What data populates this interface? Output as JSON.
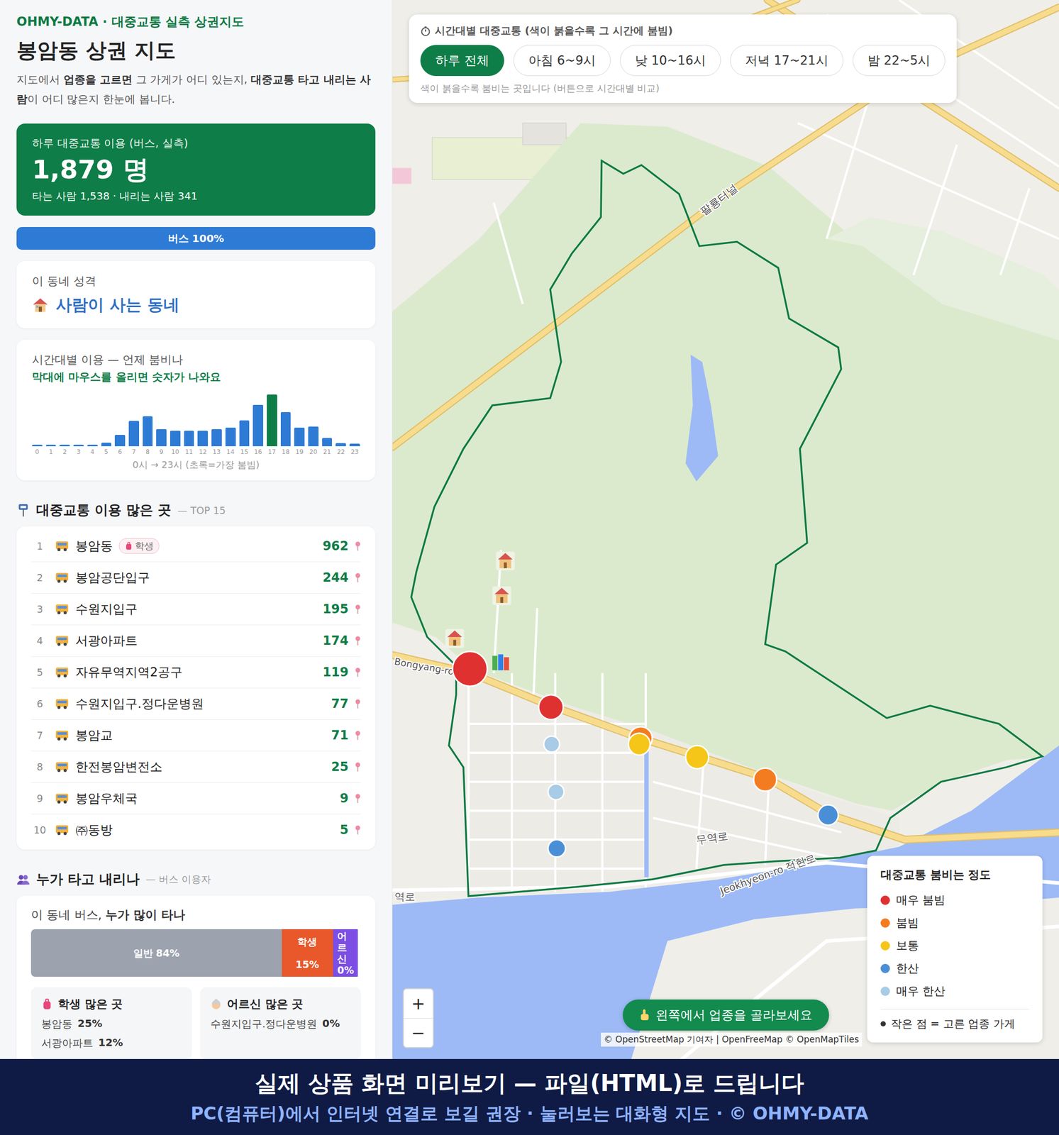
{
  "brand": "OHMY-DATA · 대중교통 실측 상권지도",
  "title": "봉암동 상권 지도",
  "description": [
    {
      "text": "지도에서 ",
      "bold": false
    },
    {
      "text": "업종을 고르면",
      "bold": true
    },
    {
      "text": " 그 가게가 어디 있는지, ",
      "bold": false
    },
    {
      "text": "대중교통 타고 내리는 사람",
      "bold": true
    },
    {
      "text": "이 어디 많은지 한눈에 봅니다.",
      "bold": false
    }
  ],
  "total": {
    "label": "하루 대중교통 이용 (버스, 실측)",
    "value": "1,879 명",
    "sub": "타는 사람 1,538 · 내리는 사람 341"
  },
  "modes": [
    {
      "label": "버스 100%",
      "level": 1,
      "color": "#2e7bd6"
    }
  ],
  "character": {
    "label": "이 동네 성격",
    "value": "사람이 사는 동네"
  },
  "hourly": {
    "title": "시간대별 이용 — 언제 붐비나",
    "hint": "막대에 마우스를 올리면 숫자가 나와요",
    "values": [
      6,
      5,
      5,
      6,
      5,
      18,
      56,
      124,
      148,
      84,
      76,
      76,
      76,
      84,
      92,
      128,
      204,
      255,
      168,
      92,
      96,
      40,
      16,
      12
    ],
    "peak": 17,
    "ticks": [
      "0",
      "1",
      "2",
      "3",
      "4",
      "5",
      "6",
      "7",
      "8",
      "9",
      "10",
      "11",
      "12",
      "13",
      "14",
      "15",
      "16",
      "17",
      "18",
      "19",
      "20",
      "21",
      "22",
      "23"
    ],
    "caption": "0시 → 23시 (초록=가장 붐빔)"
  },
  "top_stops": {
    "title": "대중교통 이용 많은 곳",
    "suffix": "— TOP 15",
    "items": [
      {
        "rank": "1",
        "name": "봉암동",
        "badge": "학생",
        "count": "962"
      },
      {
        "rank": "2",
        "name": "봉암공단입구",
        "badge": "",
        "count": "244"
      },
      {
        "rank": "3",
        "name": "수원지입구",
        "badge": "",
        "count": "195"
      },
      {
        "rank": "4",
        "name": "서광아파트",
        "badge": "",
        "count": "174"
      },
      {
        "rank": "5",
        "name": "자유무역지역2공구",
        "badge": "",
        "count": "119"
      },
      {
        "rank": "6",
        "name": "수원지입구.정다운병원",
        "badge": "",
        "count": "77"
      },
      {
        "rank": "7",
        "name": "봉암교",
        "badge": "",
        "count": "71"
      },
      {
        "rank": "8",
        "name": "한전봉암변전소",
        "badge": "",
        "count": "25"
      },
      {
        "rank": "9",
        "name": "봉암우체국",
        "badge": "",
        "count": "9"
      },
      {
        "rank": "10",
        "name": "㈜동방",
        "badge": "",
        "count": "5"
      }
    ]
  },
  "riders": {
    "title": "누가 타고 내리나",
    "suffix": "— 버스 이용자",
    "question": [
      {
        "text": "이 동네 버스, ",
        "bold": false
      },
      {
        "text": "누가 많이 타나",
        "bold": true
      }
    ],
    "segments": [
      {
        "label": "일반",
        "value": "84%",
        "level": 0.84,
        "color": "#9ca3af"
      },
      {
        "label": "학생",
        "value": "15%",
        "level": 0.15,
        "color": "#e8582a"
      },
      {
        "label": "어르신",
        "value": "0%",
        "level": 0.0,
        "color": "#7c4ee4"
      }
    ],
    "groups": [
      {
        "title": "학생 많은 곳",
        "items": [
          {
            "name": "봉암동",
            "value": "25%"
          },
          {
            "name": "서광아파트",
            "value": "12%"
          }
        ]
      },
      {
        "title": "어르신 많은 곳",
        "items": [
          {
            "name": "수원지입구.정다운병원",
            "value": "0%"
          }
        ]
      }
    ]
  },
  "time_filter": {
    "title": "시간대별 대중교통 (색이 붉을수록 그 시간에 붐빔)",
    "options": [
      {
        "label": "하루 전체",
        "selected": true
      },
      {
        "label": "아침 6~9시",
        "selected": false
      },
      {
        "label": "낮 10~16시",
        "selected": false
      },
      {
        "label": "저녁 17~21시",
        "selected": false
      },
      {
        "label": "밤 22~5시",
        "selected": false
      }
    ],
    "hint": "색이 붉을수록 붐비는 곳입니다 (버튼으로 시간대별 비교)"
  },
  "map_labels": [
    "팔룡터널",
    "Bongyang-ro",
    "무역로",
    "Jeokhyeon-ro 적현로",
    "역로"
  ],
  "pins": [
    {
      "color": "#e03131",
      "level": 1
    },
    {
      "color": "#e03131",
      "level": 0.46
    },
    {
      "color": "#f47c20",
      "level": 0.38
    },
    {
      "color": "#f5c518",
      "level": 0.31
    },
    {
      "color": "#f5c518",
      "level": 0.38
    },
    {
      "color": "#f47c20",
      "level": 0.38
    },
    {
      "color": "#4a8fd6",
      "level": 0.23
    },
    {
      "color": "#a8cbe6",
      "level": 0
    },
    {
      "color": "#a8cbe6",
      "level": 0
    },
    {
      "color": "#4a8fd6",
      "level": 0.08
    }
  ],
  "legend": {
    "title": "대중교통 붐비는 정도",
    "items": [
      {
        "label": "매우 붐빔",
        "color": "#e03131"
      },
      {
        "label": "붐빔",
        "color": "#f47c20"
      },
      {
        "label": "보통",
        "color": "#f5c518"
      },
      {
        "label": "한산",
        "color": "#4a8fd6"
      },
      {
        "label": "매우 한산",
        "color": "#a8cbe6"
      }
    ],
    "note": "작은 점 = 고른 업종 가게"
  },
  "zoom": {
    "in": "+",
    "out": "−"
  },
  "hint": "왼쪽에서 업종을 골라보세요",
  "attribution": "© OpenStreetMap 기여자 | OpenFreeMap © OpenMapTiles",
  "banner": {
    "title": "실제 상품 화면 미리보기 — 파일(HTML)로 드립니다",
    "sub": "PC(컴퓨터)에서 인터넷 연결로 보길 권장 · 눌러보는 대화형 지도 · © OHMY-DATA"
  }
}
